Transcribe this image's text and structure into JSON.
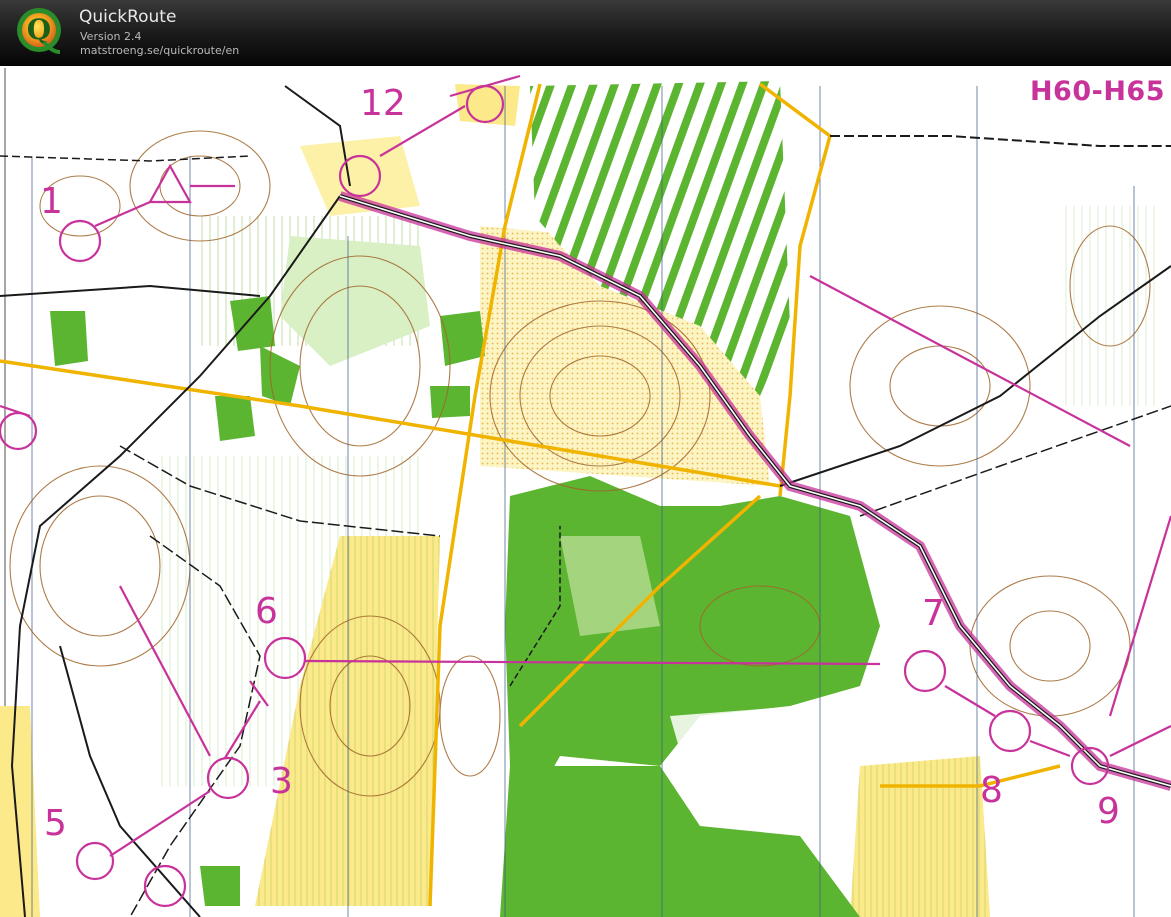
{
  "app": {
    "title": "QuickRoute",
    "version": "Version 2.4",
    "url": "matstroeng.se/quickroute/en",
    "logo_letter": "Q"
  },
  "map": {
    "class_label": "H60-H65",
    "colors": {
      "course": "#c8329b",
      "forest_green": "#5cb531",
      "light_green": "#a5d47e",
      "open_yellow": "#fbe98a",
      "road_orange": "#f0b400",
      "contour_brown": "#a0662b",
      "track_black": "#1a1a1a",
      "magnetic_blue": "#3b5a88",
      "paper": "#ffffff"
    },
    "controls": [
      {
        "number": "1"
      },
      {
        "number": "3"
      },
      {
        "number": "5"
      },
      {
        "number": "6"
      },
      {
        "number": "7"
      },
      {
        "number": "8"
      },
      {
        "number": "9"
      },
      {
        "number": "12"
      }
    ]
  }
}
